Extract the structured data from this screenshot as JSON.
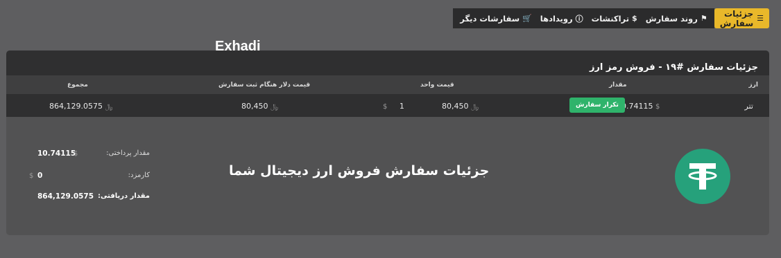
{
  "tabs": {
    "active": {
      "label": "جزئیات سفارش",
      "icon": "list-icon"
    },
    "items": [
      {
        "label": "روند سفارش",
        "icon": "flag-icon"
      },
      {
        "label": "تراکنشات",
        "icon": "dollar-icon"
      },
      {
        "label": "رویدادها",
        "icon": "info-circle-icon"
      },
      {
        "label": "سفارشات دیگر",
        "icon": "cart-icon"
      }
    ]
  },
  "watermark": "Exhadi",
  "card": {
    "title": "جزئیات سفارش #۱۹ - فروش رمز ارز",
    "columns": {
      "currency": "ارز",
      "amount": "مقدار",
      "unit_price": "قیمت واحد",
      "dollar_price": "قیمت دلار هنگام ثبت سفارش",
      "total": "مجموع"
    },
    "row": {
      "currency": "تتر",
      "amount": "10.74115",
      "amount_symbol": "$",
      "repeat_button": "تکرار سفارش",
      "unit_price_rial": "80,450",
      "unit_price_usd": "1",
      "dollar_price": "80,450",
      "total": "864,129.0575",
      "rial_symbol": "﷼",
      "usd_symbol": "$"
    }
  },
  "summary": {
    "paid_label": "مقدار پرداختی:",
    "paid_value": "10.74115",
    "fee_label": "کارمزد:",
    "fee_value": "0",
    "received_label": "مقدار دریافتی:",
    "received_value": "864,129.0575"
  },
  "caption": "جزئیات سفارش فروش ارز دیجیتال شما",
  "colors": {
    "accent": "#e9b82a",
    "success": "#2fb36b",
    "tether": "#26a17b"
  }
}
